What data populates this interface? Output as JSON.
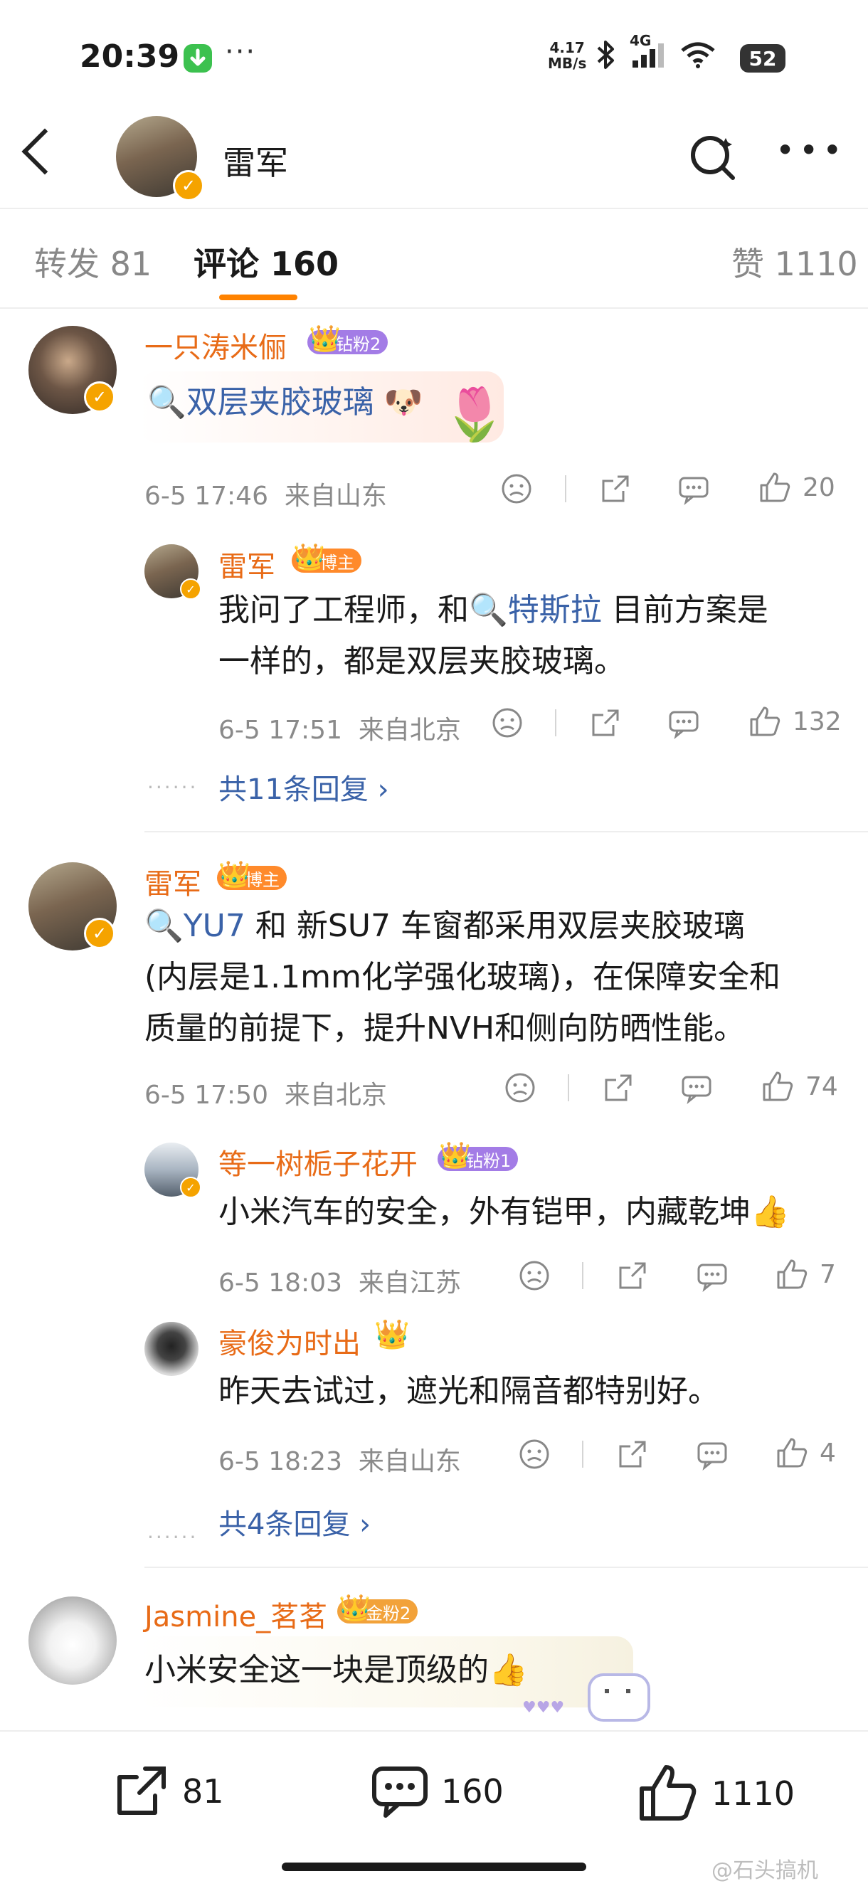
{
  "status": {
    "time": "20:39",
    "net_speed_value": "4.17",
    "net_speed_unit": "MB/s",
    "signal_label": "4G",
    "battery": "52"
  },
  "header": {
    "name": "雷军"
  },
  "tabs": {
    "repost": "转发 81",
    "comments": "评论 160",
    "likes": "赞 1110"
  },
  "comments": [
    {
      "name": "一只涛米俪",
      "badge": "钻粉2",
      "text_link": "双层夹胶玻璃",
      "emoji": "🐶",
      "time": "6-5 17:46",
      "location": "来自山东",
      "likes": "20",
      "replies": [
        {
          "name": "雷军",
          "badge": "博主",
          "line1_pre": "我问了工程师，和",
          "line1_link": "特斯拉",
          "line1_post": " 目前方案是",
          "line2": "一样的，都是双层夹胶玻璃。",
          "time": "6-5 17:51",
          "location": "来自北京",
          "likes": "132"
        }
      ],
      "more_replies": "共11条回复 ›"
    },
    {
      "name": "雷军",
      "badge": "博主",
      "line1_link": "YU7",
      "line1_post": " 和 新SU7 车窗都采用双层夹胶玻璃",
      "line2": "(内层是1.1mm化学强化玻璃)，在保障安全和",
      "line3": "质量的前提下，提升NVH和侧向防晒性能。",
      "time": "6-5 17:50",
      "location": "来自北京",
      "likes": "74",
      "replies": [
        {
          "name": "等一树栀子花开",
          "badge": "钻粉1",
          "text": "小米汽车的安全，外有铠甲，内藏乾坤👍",
          "time": "6-5 18:03",
          "location": "来自江苏",
          "likes": "7"
        },
        {
          "name": "豪俊为时出",
          "badge": "",
          "text": "昨天去试过，遮光和隔音都特别好。",
          "time": "6-5 18:23",
          "location": "来自山东",
          "likes": "4"
        }
      ],
      "more_replies": "共4条回复 ›"
    },
    {
      "name": "Jasmine_茗茗",
      "badge": "金粉2",
      "text": "小米安全这一块是顶级的👍"
    }
  ],
  "bottom_bar": {
    "reposts": "81",
    "comments": "160",
    "likes": "1110"
  },
  "watermark": "@石头搞机",
  "colors": {
    "accent": "#ff8200",
    "name": "#e86b17",
    "link": "#3a62a8",
    "meta": "#8a8a8a",
    "badge_purple": "#a37ce6",
    "badge_orange": "#ff8a2b",
    "badge_gold": "#f2a23a"
  }
}
